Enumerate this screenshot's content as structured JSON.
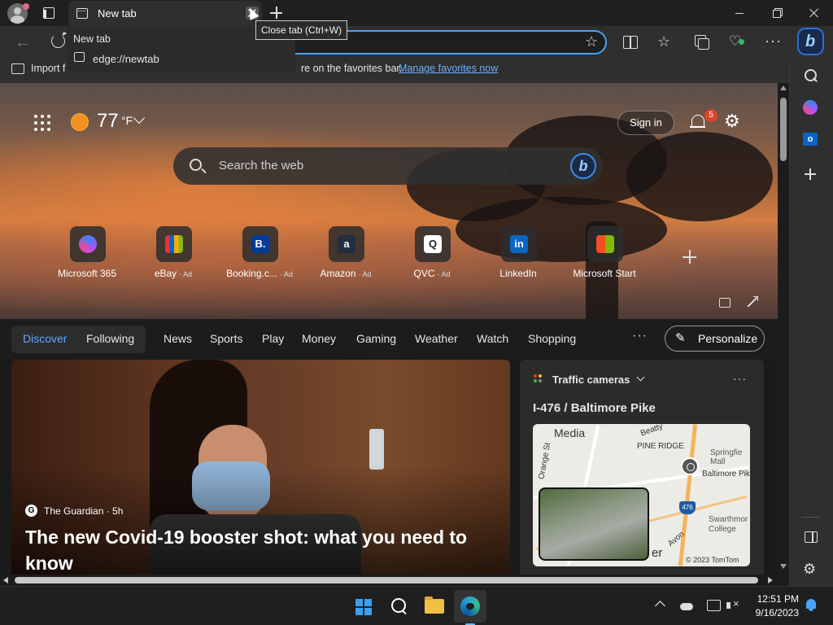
{
  "browser": {
    "tab_title": "New tab",
    "tab_tooltip": "Close tab (Ctrl+W)",
    "tab_dropdown": {
      "title": "New tab",
      "url": "edge://newtab"
    },
    "favorites_bar": {
      "import_prefix": "Import f",
      "message_suffix": "re on the favorites bar.",
      "manage_link": "Manage favorites now"
    }
  },
  "newtab": {
    "weather": {
      "temperature": "77",
      "unit": "°F"
    },
    "sign_in_label": "Sign in",
    "notification_count": "5",
    "search_placeholder": "Search the web",
    "tiles": [
      {
        "label": "Microsoft 365",
        "ad": "",
        "icon": "microsoft-365-icon",
        "color": "#6b5bd6"
      },
      {
        "label": "eBay",
        "ad": "· Ad",
        "icon": "ebay-icon",
        "color": "#e53238"
      },
      {
        "label": "Booking.c...",
        "ad": "· Ad",
        "icon": "booking-icon",
        "color": "#003b95"
      },
      {
        "label": "Amazon",
        "ad": "· Ad",
        "icon": "amazon-icon",
        "color": "#232f3e"
      },
      {
        "label": "QVC",
        "ad": "· Ad",
        "icon": "qvc-icon",
        "color": "#ffffff"
      },
      {
        "label": "LinkedIn",
        "ad": "",
        "icon": "linkedin-icon",
        "color": "#0a66c2"
      },
      {
        "label": "Microsoft Start",
        "ad": "",
        "icon": "microsoft-start-icon",
        "color": "#f25022"
      }
    ],
    "tile_glyphs": {
      "booking": "B.",
      "amazon": "a",
      "qvc": "Q",
      "linkedin": "in"
    },
    "feed_nav": {
      "discover": "Discover",
      "following": "Following",
      "items": [
        "News",
        "Sports",
        "Play",
        "Money",
        "Gaming",
        "Weather",
        "Watch",
        "Shopping"
      ],
      "more": "···",
      "personalize": "Personalize"
    },
    "news_card": {
      "source": "The Guardian · 5h",
      "source_glyph": "G",
      "headline": "The new Covid-19 booster shot: what you need to know"
    },
    "traffic_card": {
      "title": "Traffic cameras",
      "more": "···",
      "camera_name": "I-476 / Baltimore Pike",
      "map_labels": {
        "media": "Media",
        "pine_ridge": "PINE RIDGE",
        "beatty": "Beatty",
        "springfield_mall": "Springfie Mall",
        "baltimore_pike": "Baltimore Pike",
        "orange_st": "Orange St",
        "swarthmore": "Swarthmor College",
        "route": "476",
        "copyright": "© 2023 TomTom",
        "partial_er": "er",
        "partial_avon": "Avon"
      }
    }
  },
  "taskbar": {
    "time": "12:51 PM",
    "date": "9/16/2023"
  },
  "colors": {
    "accent_blue": "#4b9ef5",
    "discover_blue": "#5aa8ff",
    "link_blue": "#6cb0ff"
  }
}
